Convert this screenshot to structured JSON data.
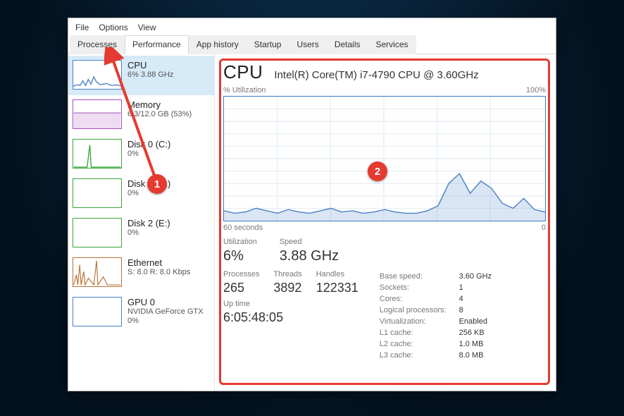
{
  "menubar": [
    "File",
    "Options",
    "View"
  ],
  "tabs": [
    "Processes",
    "Performance",
    "App history",
    "Startup",
    "Users",
    "Details",
    "Services"
  ],
  "active_tab": 1,
  "sidebar": [
    {
      "key": "cpu",
      "title": "CPU",
      "sub": "6% 3.88 GHz",
      "selected": true,
      "color": "#4a82c3"
    },
    {
      "key": "memory",
      "title": "Memory",
      "sub": "6.3/12.0 GB (53%)",
      "color": "#a64fbd"
    },
    {
      "key": "disk0",
      "title": "Disk 0 (C:)",
      "sub": "0%",
      "color": "#3aa53a"
    },
    {
      "key": "disk1",
      "title": "Disk 1 (D:)",
      "sub": "0%",
      "color": "#3aa53a"
    },
    {
      "key": "disk2",
      "title": "Disk 2 (E:)",
      "sub": "0%",
      "color": "#3aa53a"
    },
    {
      "key": "ethernet",
      "title": "Ethernet",
      "sub": "S: 8.0 R: 8.0 Kbps",
      "color": "#b87333"
    },
    {
      "key": "gpu0",
      "title": "GPU 0",
      "sub": "NVIDIA GeForce GTX\n0%",
      "color": "#4a82c3"
    }
  ],
  "cpu_panel": {
    "heading": "CPU",
    "model": "Intel(R) Core(TM) i7-4790 CPU @ 3.60GHz",
    "chart_left_label": "% Utilization",
    "chart_right_label": "100%",
    "x_left": "60 seconds",
    "x_right": "0",
    "primary": {
      "utilization_label": "Utilization",
      "utilization_value": "6%",
      "speed_label": "Speed",
      "speed_value": "3.88 GHz"
    },
    "secondary": {
      "processes_label": "Processes",
      "processes_value": "265",
      "threads_label": "Threads",
      "threads_value": "3892",
      "handles_label": "Handles",
      "handles_value": "122331",
      "uptime_label": "Up time",
      "uptime_value": "6:05:48:05"
    },
    "spec": [
      [
        "Base speed:",
        "3.60 GHz"
      ],
      [
        "Sockets:",
        "1"
      ],
      [
        "Cores:",
        "4"
      ],
      [
        "Logical processors:",
        "8"
      ],
      [
        "Virtualization:",
        "Enabled"
      ],
      [
        "L1 cache:",
        "256 KB"
      ],
      [
        "L2 cache:",
        "1.0 MB"
      ],
      [
        "L3 cache:",
        "8.0 MB"
      ]
    ]
  },
  "annotations": {
    "badge1": "1",
    "badge2": "2"
  },
  "chart_data": {
    "type": "line",
    "title": "% Utilization",
    "xlabel": "seconds ago",
    "ylabel": "% Utilization",
    "ylim": [
      0,
      100
    ],
    "x": [
      60,
      58,
      56,
      54,
      52,
      50,
      48,
      46,
      44,
      42,
      40,
      38,
      36,
      34,
      32,
      30,
      28,
      26,
      24,
      22,
      20,
      18,
      16,
      14,
      12,
      10,
      8,
      6,
      4,
      2,
      0
    ],
    "values": [
      8,
      6,
      7,
      10,
      8,
      6,
      9,
      7,
      6,
      8,
      10,
      7,
      8,
      6,
      7,
      9,
      7,
      6,
      6,
      8,
      12,
      30,
      38,
      22,
      32,
      26,
      14,
      10,
      18,
      9,
      7
    ]
  }
}
